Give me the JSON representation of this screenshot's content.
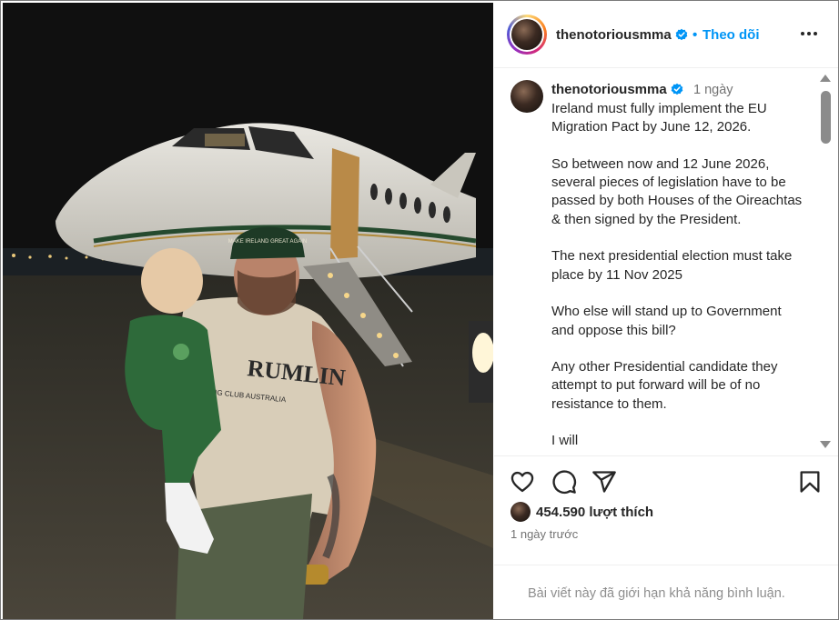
{
  "post": {
    "username": "thenotoriousmma",
    "follow_separator": "•",
    "follow_label": "Theo dõi",
    "caption_time": "1 ngày",
    "caption": "Ireland must fully implement the EU Migration Pact by June 12, 2026.\n\nSo between now and 12 June 2026, several pieces of legislation have to be passed by both Houses of the Oireachtas & then signed by the President.\n\nThe next presidential election must take place by 11 Nov 2025\n\nWho else will stand up to Government and oppose this bill?\n\nAny other Presidential candidate they attempt to put forward will be of no resistance to them.\n\nI will",
    "likes": "454.590 lượt thích",
    "posted_time": "1 ngày trước",
    "comments_notice": "Bài viết này đã giới hạn khả năng bình luận."
  },
  "photo": {
    "cap_text": "MAKE IRELAND GREAT AGAIN",
    "shirt_text_main": "RUMLIN",
    "shirt_text_sub": "XING CLUB AUSTRALIA"
  },
  "colors": {
    "accent": "#0095f6",
    "text": "#262626",
    "muted": "#737373",
    "border": "#efefef"
  },
  "icons": {
    "verified": "verified-badge-icon",
    "more": "more-options-icon",
    "like": "heart-icon",
    "comment": "comment-icon",
    "share": "send-icon",
    "save": "bookmark-icon"
  }
}
